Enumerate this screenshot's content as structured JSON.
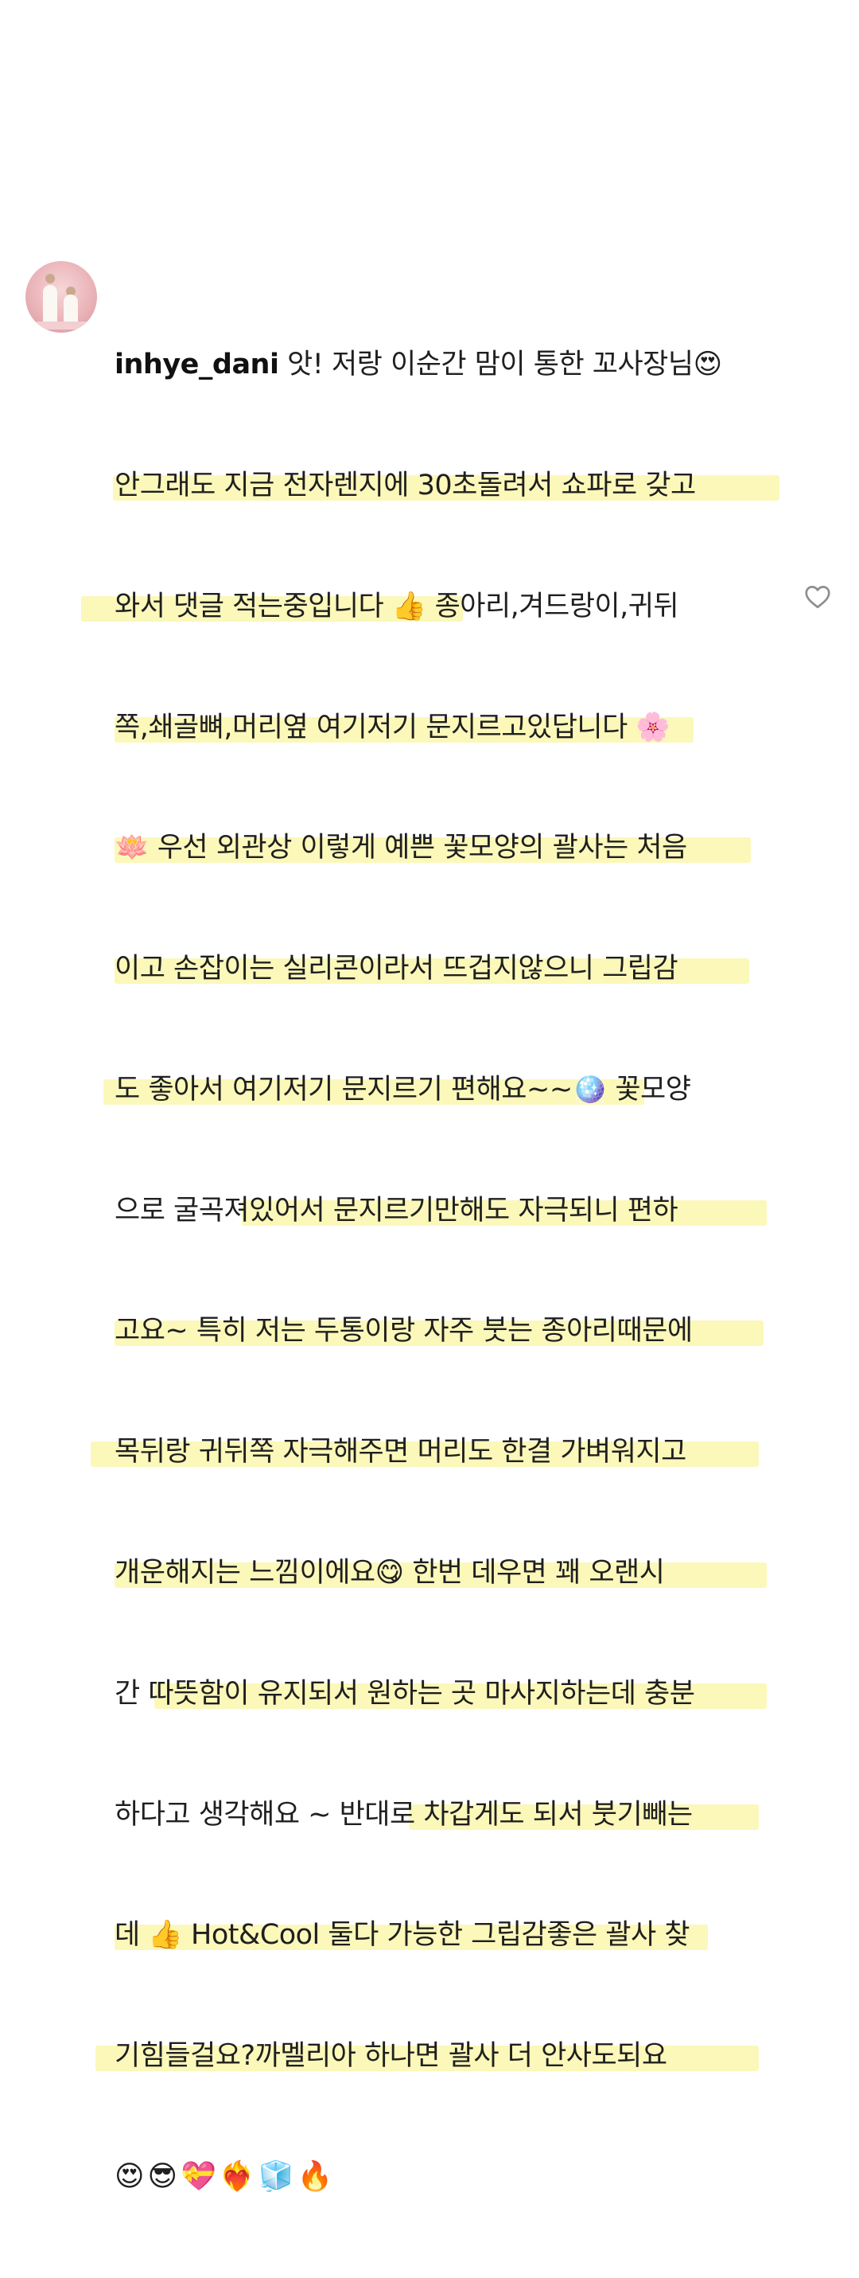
{
  "comment": {
    "username": "inhye_dani",
    "lines": [
      " 앗! 저랑 이순간 맘이 통한 꼬사장님😍",
      "안그래도 지금 전자렌지에 30초돌려서 쇼파로 갖고",
      "와서 댓글 적는중입니다 👍 종아리,겨드랑이,귀뒤",
      "쪽,쇄골뼈,머리옆 여기저기 문지르고있답니다 🌸",
      "🪷 우선 외관상 이렇게 예쁜 꽃모양의 괄사는 처음",
      "이고 손잡이는 실리콘이라서 뜨겁지않으니 그립감",
      "도 좋아서 여기저기 문지르기 편해요~~🪩 꽃모양",
      "으로 굴곡져있어서 문지르기만해도 자극되니 편하",
      "고요~ 특히 저는 두통이랑 자주 붓는 종아리때문에",
      "목뒤랑 귀뒤쪽 자극해주면 머리도 한결 가벼워지고",
      "개운해지는 느낌이에요😋 한번 데우면 꽤 오랜시",
      "간 따뜻함이 유지되서 원하는 곳 마사지하는데 충분",
      "하다고 생각해요 ~ 반대로 차갑게도 되서 붓기빼는",
      "데 👍 Hot&Cool 둘다 가능한 그립감좋은 괄사 찾",
      "기힘들걸요?까멜리아 하나면 괄사 더 안사도되요"
    ],
    "emojis": "😍😎💝❤️‍🔥🧊🔥"
  },
  "icons": {
    "avatar": "avatar-photo",
    "like": "heart-outline-icon"
  },
  "colors": {
    "highlight": "#fbf7b3",
    "text": "#1f1f1f"
  }
}
